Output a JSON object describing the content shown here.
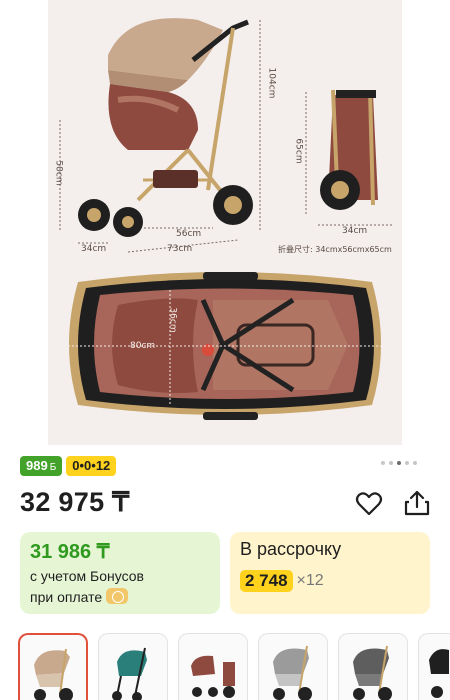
{
  "product_image": {
    "dimensions": {
      "height_total": "104cm",
      "seat_height": "50cm",
      "folded_height": "65cm",
      "wheelbase": "56cm",
      "length": "73cm",
      "wheel_width": "34cm",
      "folded_width": "34cm",
      "folded_size": "折叠尺寸: 34cmx56cmx65cm",
      "bassinet_length": "80cm",
      "bassinet_width": "36cm"
    },
    "colors": {
      "canopy": "#c9a98d",
      "seat": "#8e4a3f",
      "frame": "#c7a46a",
      "bassinet_inner": "#a8665a"
    }
  },
  "badges": {
    "bonus": "989",
    "bonus_currency": "Б",
    "installment_code": "0•0•12"
  },
  "gallery_dots": {
    "count": 5,
    "active_index": 2
  },
  "price": {
    "main": "32 975 ₸"
  },
  "actions": {
    "favorite_icon": "heart-icon",
    "share_icon": "share-icon"
  },
  "bonus_card": {
    "price": "31 986 ₸",
    "line1": "с учетом Бонусов",
    "line2": "при оплате"
  },
  "installment_card": {
    "title": "В рассрочку",
    "amount": "2 748",
    "multiplier": "×12"
  },
  "thumbnails": [
    {
      "variant": "beige",
      "selected": true
    },
    {
      "variant": "teal",
      "selected": false
    },
    {
      "variant": "brown",
      "selected": false
    },
    {
      "variant": "grey",
      "selected": false
    },
    {
      "variant": "dark-grey",
      "selected": false
    },
    {
      "variant": "black",
      "selected": false
    }
  ],
  "accent_colors": {
    "green": "#43a22a",
    "yellow": "#ffd21e",
    "selected_border": "#e1503a"
  }
}
